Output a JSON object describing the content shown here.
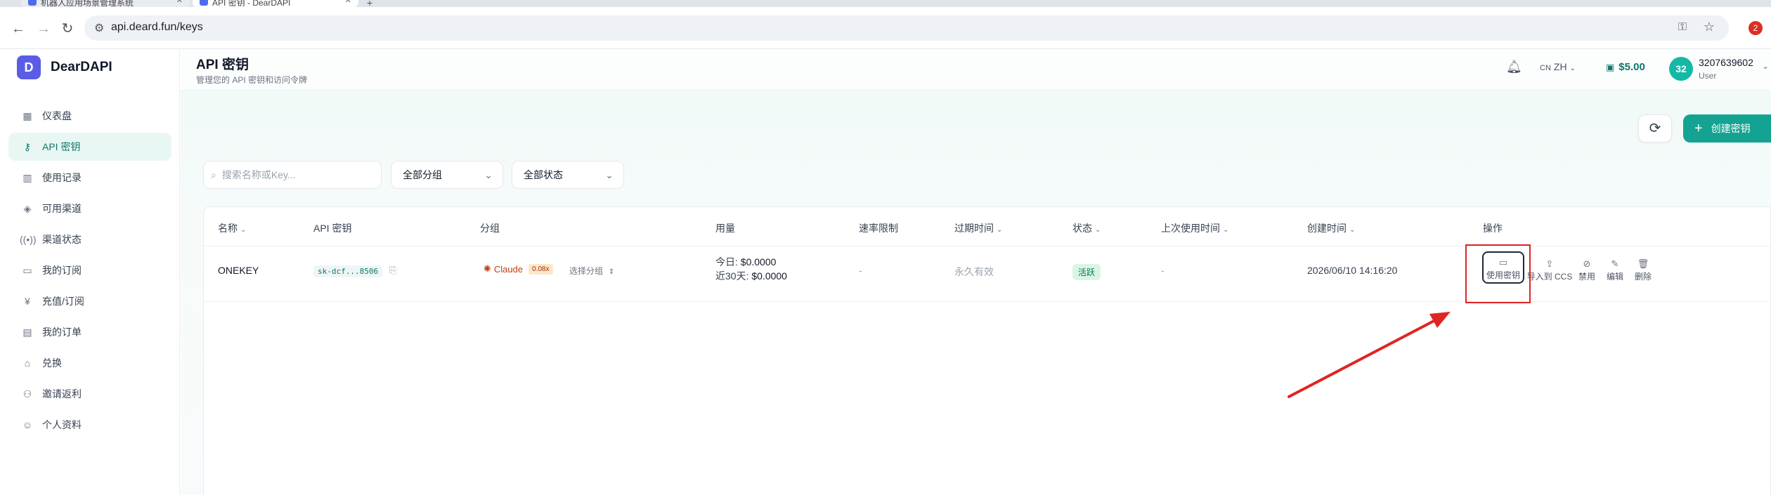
{
  "browser": {
    "tabs": [
      {
        "label": "机器人应用场景管理系统"
      },
      {
        "label": "API 密钥 - DearDAPI"
      }
    ],
    "new_tab": "+",
    "url": "api.deard.fun/keys",
    "extension_badge": "2"
  },
  "sidebar": {
    "logo_letter": "D",
    "brand": "DearDAPI",
    "items": [
      {
        "label": "仪表盘",
        "icon": "grid-icon"
      },
      {
        "label": "API 密钥",
        "icon": "key-icon",
        "active": true
      },
      {
        "label": "使用记录",
        "icon": "bar-chart-icon"
      },
      {
        "label": "可用渠道",
        "icon": "layers-icon"
      },
      {
        "label": "渠道状态",
        "icon": "signal-icon"
      },
      {
        "label": "我的订阅",
        "icon": "card-icon"
      },
      {
        "label": "充值/订阅",
        "icon": "yen-icon"
      },
      {
        "label": "我的订单",
        "icon": "document-icon"
      },
      {
        "label": "兑换",
        "icon": "gift-icon"
      },
      {
        "label": "邀请返利",
        "icon": "users-icon"
      },
      {
        "label": "个人资料",
        "icon": "user-icon"
      }
    ]
  },
  "header": {
    "title": "API 密钥",
    "subtitle": "管理您的 API 密钥和访问令牌",
    "lang_flag": "CN",
    "lang": "ZH",
    "balance": "$5.00",
    "avatar_text": "32",
    "user_name": "3207639602",
    "user_role": "User"
  },
  "actions": {
    "create_label": "创建密钥"
  },
  "filters": {
    "search_placeholder": "搜索名称或Key...",
    "group_select": "全部分组",
    "status_select": "全部状态"
  },
  "table": {
    "columns": [
      "名称",
      "API 密钥",
      "分组",
      "用量",
      "速率限制",
      "过期时间",
      "状态",
      "上次使用时间",
      "创建时间",
      "操作"
    ],
    "rows": [
      {
        "name": "ONEKEY",
        "api_key": "sk-dcf...8506",
        "group": "Claude",
        "group_multiplier": "0.08x",
        "group_select": "选择分组",
        "usage_today_label": "今日:",
        "usage_today": "$0.0000",
        "usage_30d_label": "近30天:",
        "usage_30d": "$0.0000",
        "rate_limit": "-",
        "expires": "永久有效",
        "status": "活跃",
        "last_used": "-",
        "created": "2026/06/10 14:16:20",
        "ops": [
          "使用密钥",
          "导入到 CCS",
          "禁用",
          "编辑",
          "删除"
        ]
      }
    ]
  },
  "colors": {
    "accent": "#14a393",
    "brand": "#5b5ce6",
    "highlight": "#e02424"
  }
}
